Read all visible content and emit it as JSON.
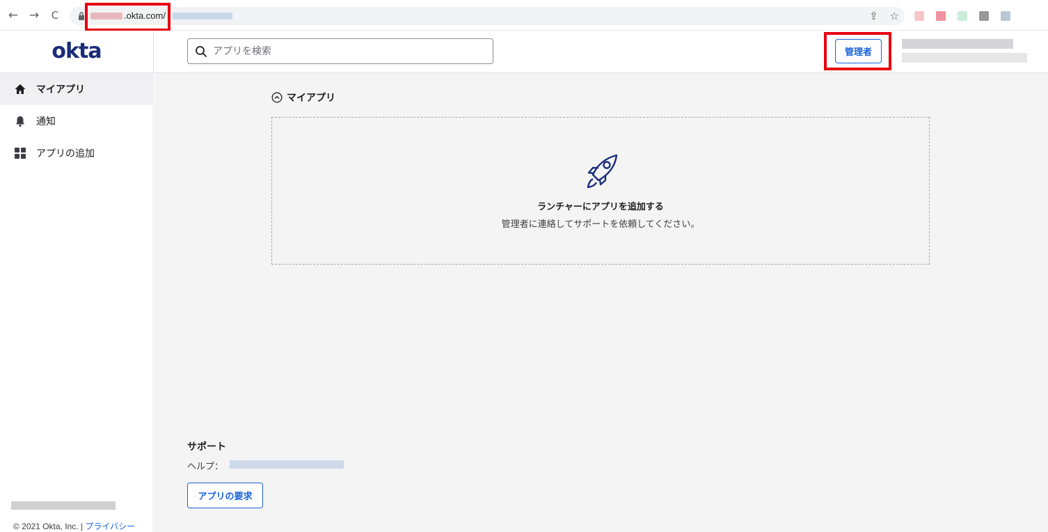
{
  "browser": {
    "back_icon": "←",
    "forward_icon": "→",
    "reload_icon": "C",
    "url_visible": ".okta.com/",
    "share_icon": "⇪",
    "star_icon": "☆"
  },
  "header": {
    "logo": "okta",
    "search_placeholder": "アプリを検索",
    "admin_label": "管理者"
  },
  "sidebar": {
    "items": [
      {
        "label": "マイアプリ",
        "icon": "home-icon",
        "active": true
      },
      {
        "label": "通知",
        "icon": "bell-icon",
        "active": false
      },
      {
        "label": "アプリの追加",
        "icon": "grid-icon",
        "active": false
      }
    ],
    "copyright": "© 2021 Okta, Inc. |",
    "privacy_link": "プライバシー"
  },
  "main": {
    "section_title": "マイアプリ",
    "empty_title": "ランチャーにアプリを追加する",
    "empty_subtitle": "管理者に連絡してサポートを依頼してください。",
    "support_title": "サポート",
    "help_label": "ヘルプ：",
    "request_button": "アプリの要求"
  },
  "colors": {
    "brand": "#1a2c7a",
    "accent": "#1662dd",
    "highlight": "#e60012"
  }
}
